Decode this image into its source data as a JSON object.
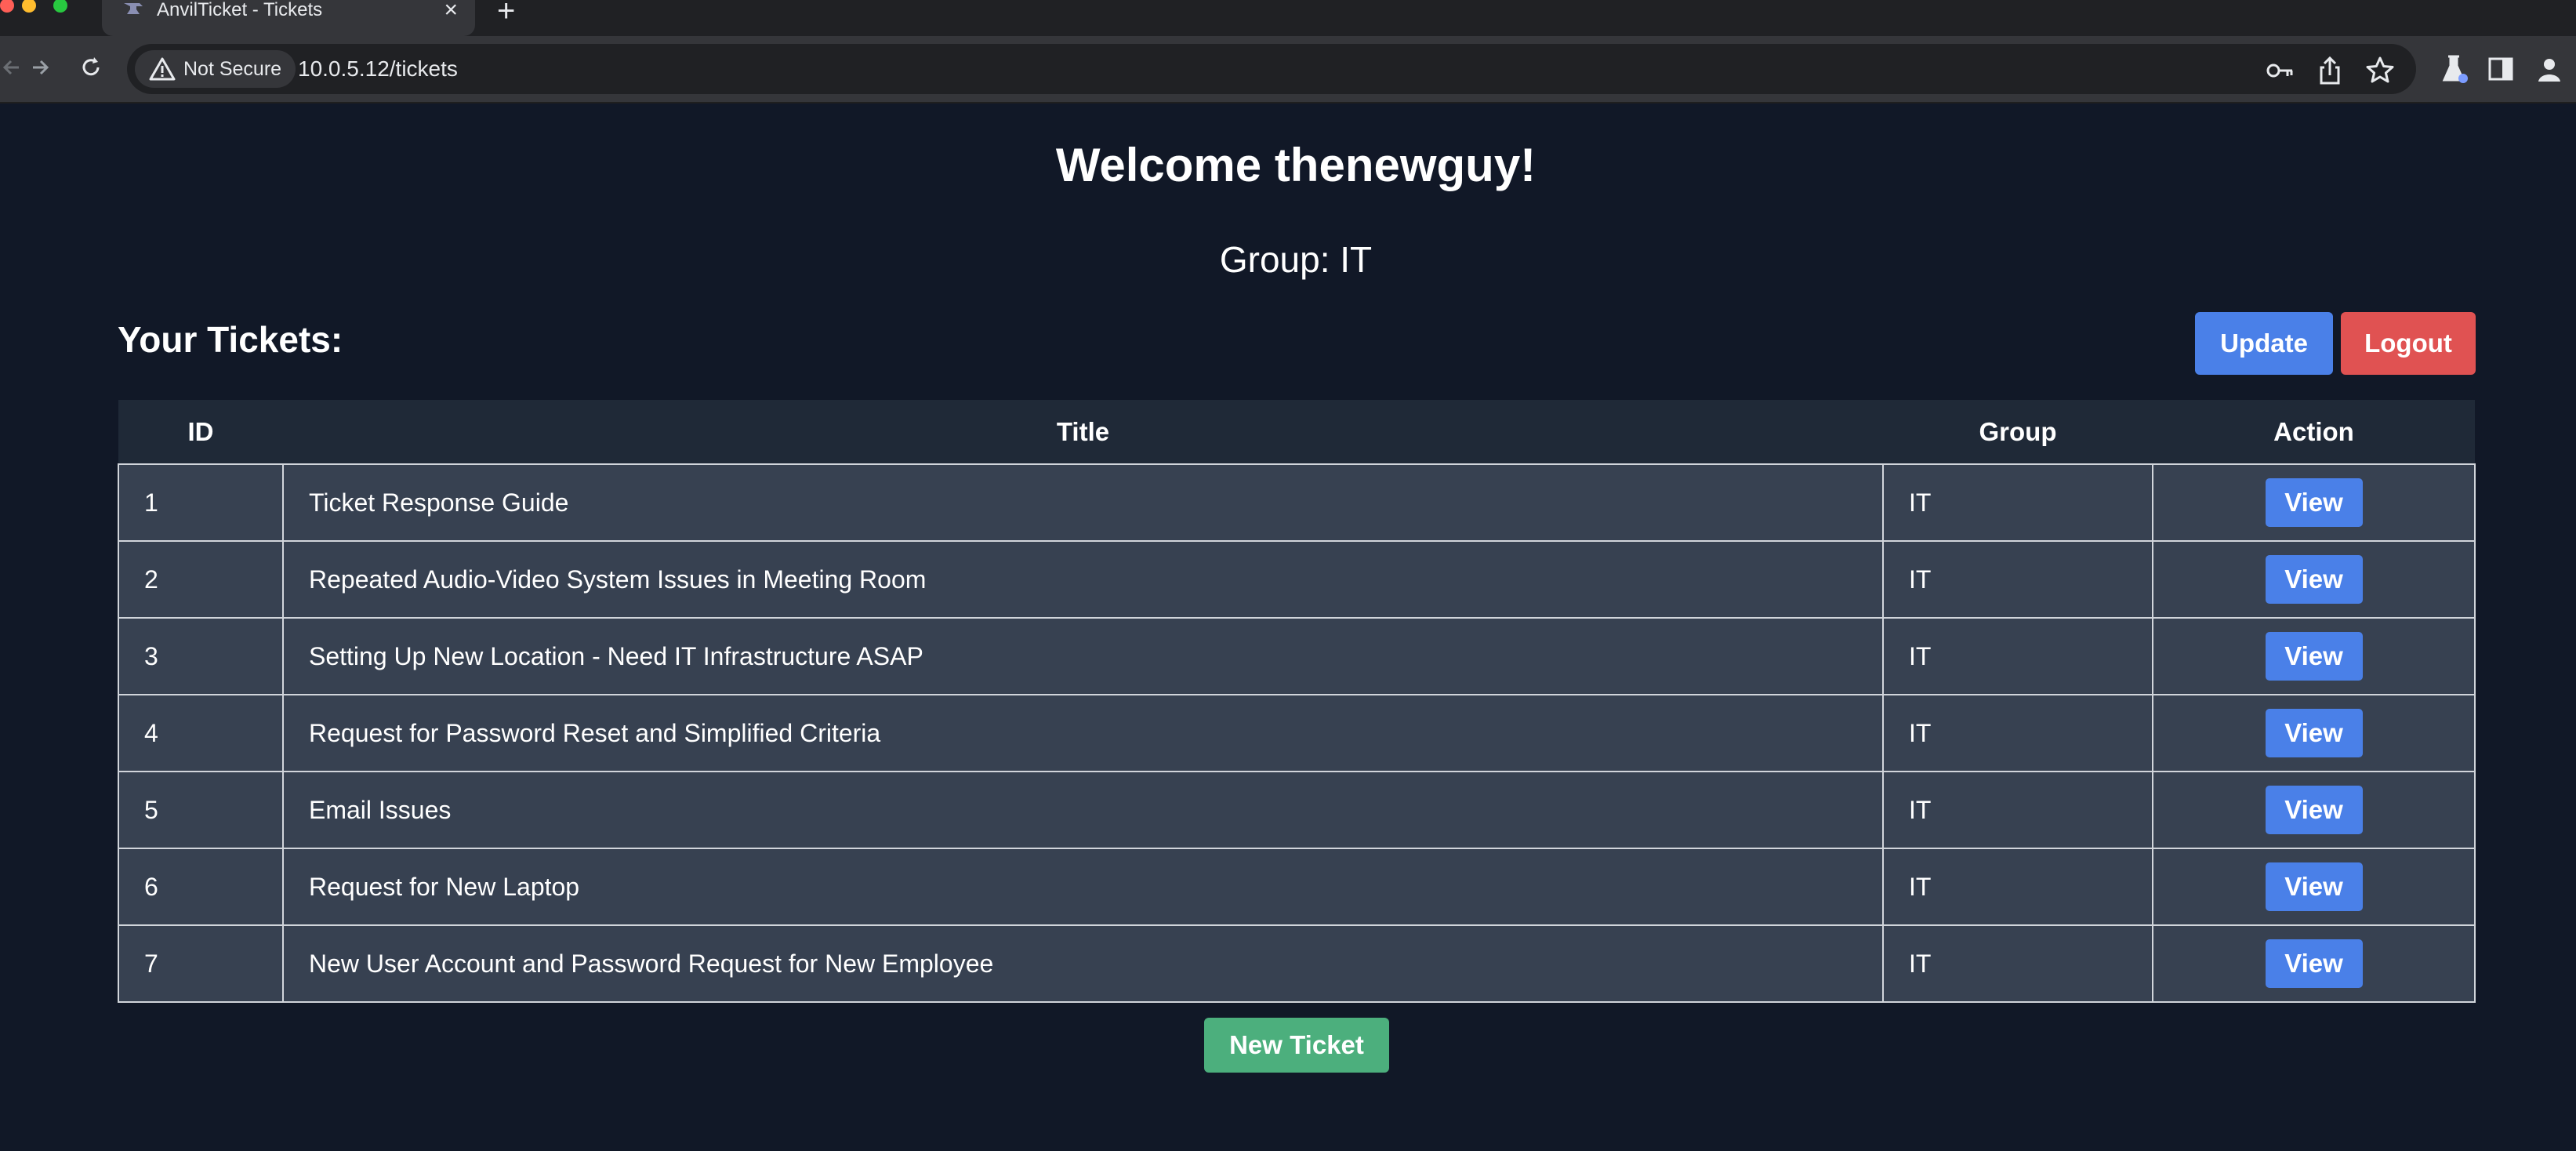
{
  "browser": {
    "tab_title": "AnvilTicket - Tickets",
    "security_chip": "Not Secure",
    "url": "10.0.5.12/tickets",
    "icons": [
      "back-icon",
      "forward-icon",
      "reload-icon",
      "warning-icon",
      "key-icon",
      "share-icon",
      "star-icon",
      "labs-icon",
      "sidebar-icon",
      "profile-icon",
      "close-icon",
      "plus-icon"
    ]
  },
  "page": {
    "welcome": "Welcome thenewguy!",
    "group": "Group: IT",
    "tickets_heading": "Your Tickets:",
    "update_label": "Update",
    "logout_label": "Logout",
    "new_ticket_label": "New Ticket",
    "colors": {
      "blue": "#4a80e8",
      "red": "#e05252",
      "green": "#4caf7d",
      "bg": "#111827",
      "row": "#374151",
      "header": "#1f2937"
    }
  },
  "table": {
    "headers": {
      "id": "ID",
      "title": "Title",
      "group": "Group",
      "action": "Action"
    },
    "rows": [
      {
        "id": "1",
        "title": "Ticket Response Guide",
        "group": "IT",
        "action": "View"
      },
      {
        "id": "2",
        "title": "Repeated Audio-Video System Issues in Meeting Room",
        "group": "IT",
        "action": "View"
      },
      {
        "id": "3",
        "title": "Setting Up New Location - Need IT Infrastructure ASAP",
        "group": "IT",
        "action": "View"
      },
      {
        "id": "4",
        "title": "Request for Password Reset and Simplified Criteria",
        "group": "IT",
        "action": "View"
      },
      {
        "id": "5",
        "title": "Email Issues",
        "group": "IT",
        "action": "View"
      },
      {
        "id": "6",
        "title": "Request for New Laptop",
        "group": "IT",
        "action": "View"
      },
      {
        "id": "7",
        "title": "New User Account and Password Request for New Employee",
        "group": "IT",
        "action": "View"
      }
    ]
  }
}
